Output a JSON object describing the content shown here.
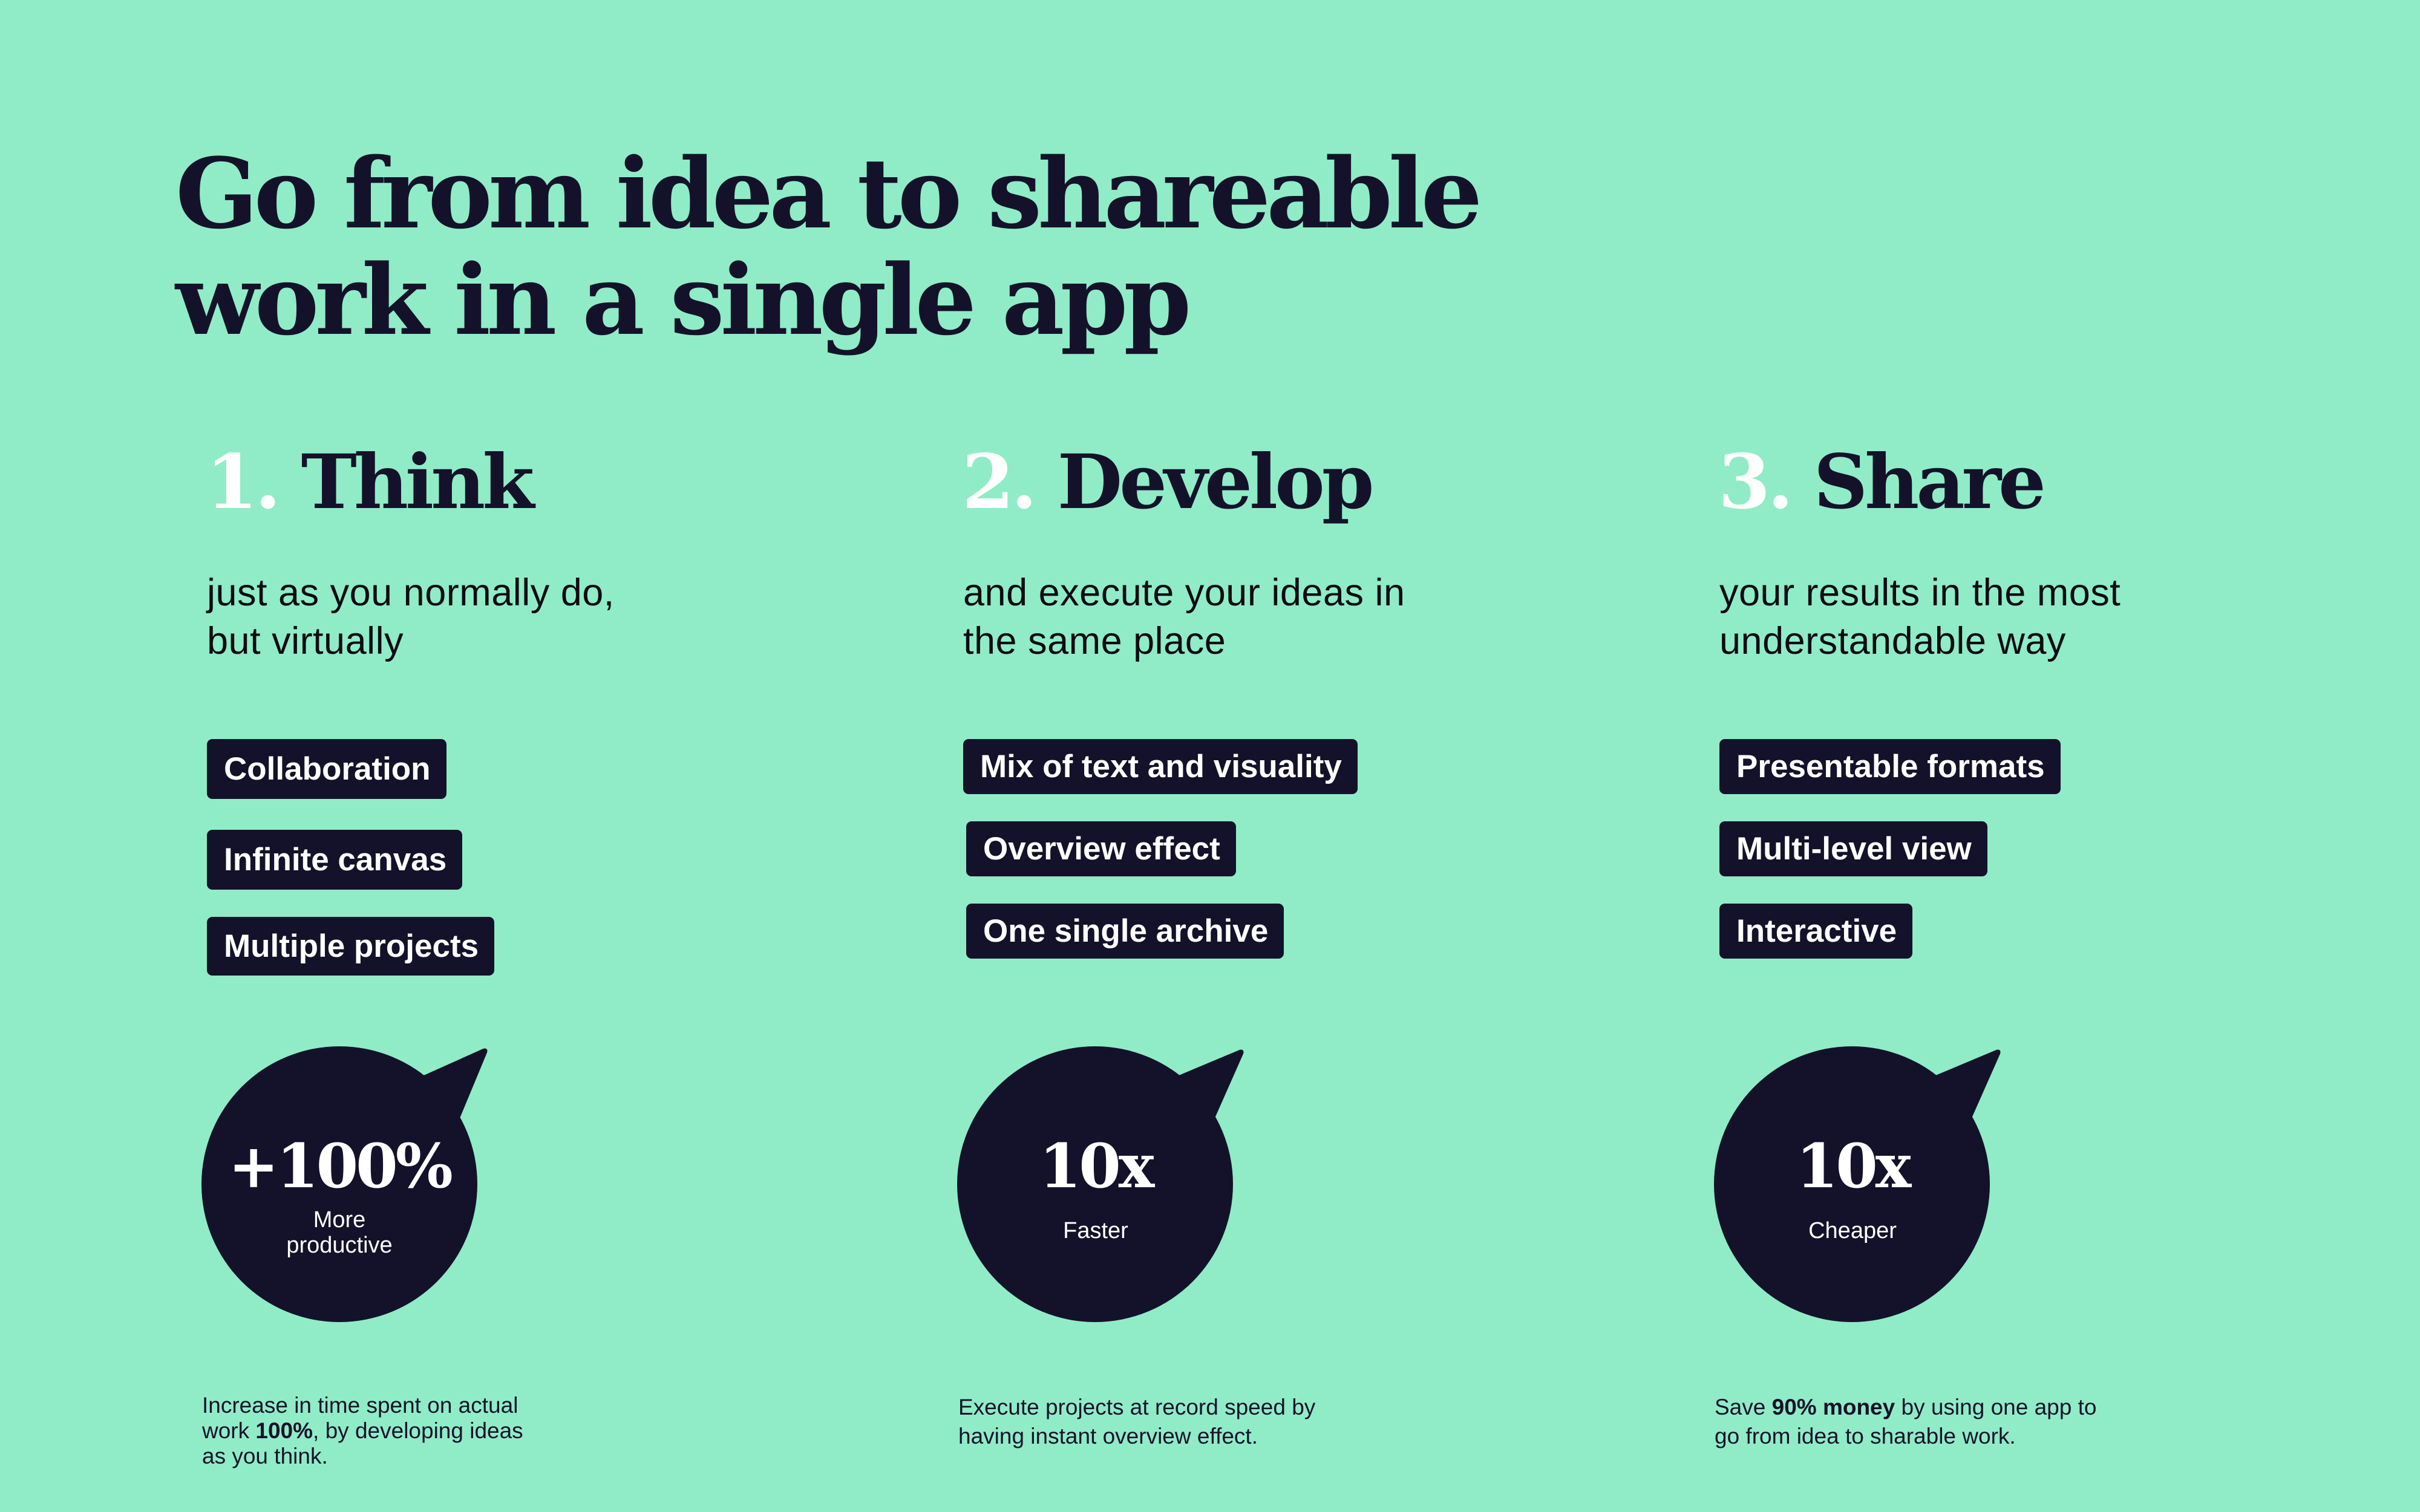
{
  "headline": {
    "line1": "Go from idea to shareable",
    "line2": "work in a single app"
  },
  "colors": {
    "background": "#8FECC7",
    "dark": "#14122A",
    "number": "#FFFFFF"
  },
  "columns": [
    {
      "number": "1.",
      "title": "Think",
      "subtitle_lines": [
        "just as you normally do,",
        "but virtually"
      ],
      "tags": [
        "Collaboration",
        "Infinite canvas",
        "Multiple projects"
      ],
      "bubble": {
        "icon": "speech-bubble-icon",
        "value": "+100%",
        "label": "More\nproductive"
      },
      "caption": {
        "line1": "Increase in time spent on actual",
        "line2_before": "work ",
        "line2_bold": "100%",
        "line2_after": ", by developing ideas",
        "line3": "as you think."
      }
    },
    {
      "number": "2.",
      "title": "Develop",
      "subtitle_lines": [
        "and execute your ideas in",
        "the same place"
      ],
      "tags": [
        "Mix of text and visuality",
        "Overview effect",
        "One single archive"
      ],
      "bubble": {
        "icon": "speech-bubble-icon",
        "value": "10x",
        "label": "Faster"
      },
      "caption": {
        "line1": "Execute projects at record speed by",
        "line2": "having instant overview effect."
      }
    },
    {
      "number": "3.",
      "title": "Share",
      "subtitle_lines": [
        "your results in the most",
        "understandable way"
      ],
      "tags": [
        "Presentable formats",
        "Multi-level view",
        "Interactive"
      ],
      "bubble": {
        "icon": "speech-bubble-icon",
        "value": "10x",
        "label": "Cheaper"
      },
      "caption": {
        "line1_before": "Save ",
        "line1_bold": "90% money",
        "line1_after": " by using one app to",
        "line2": "go from idea to sharable work."
      }
    }
  ]
}
